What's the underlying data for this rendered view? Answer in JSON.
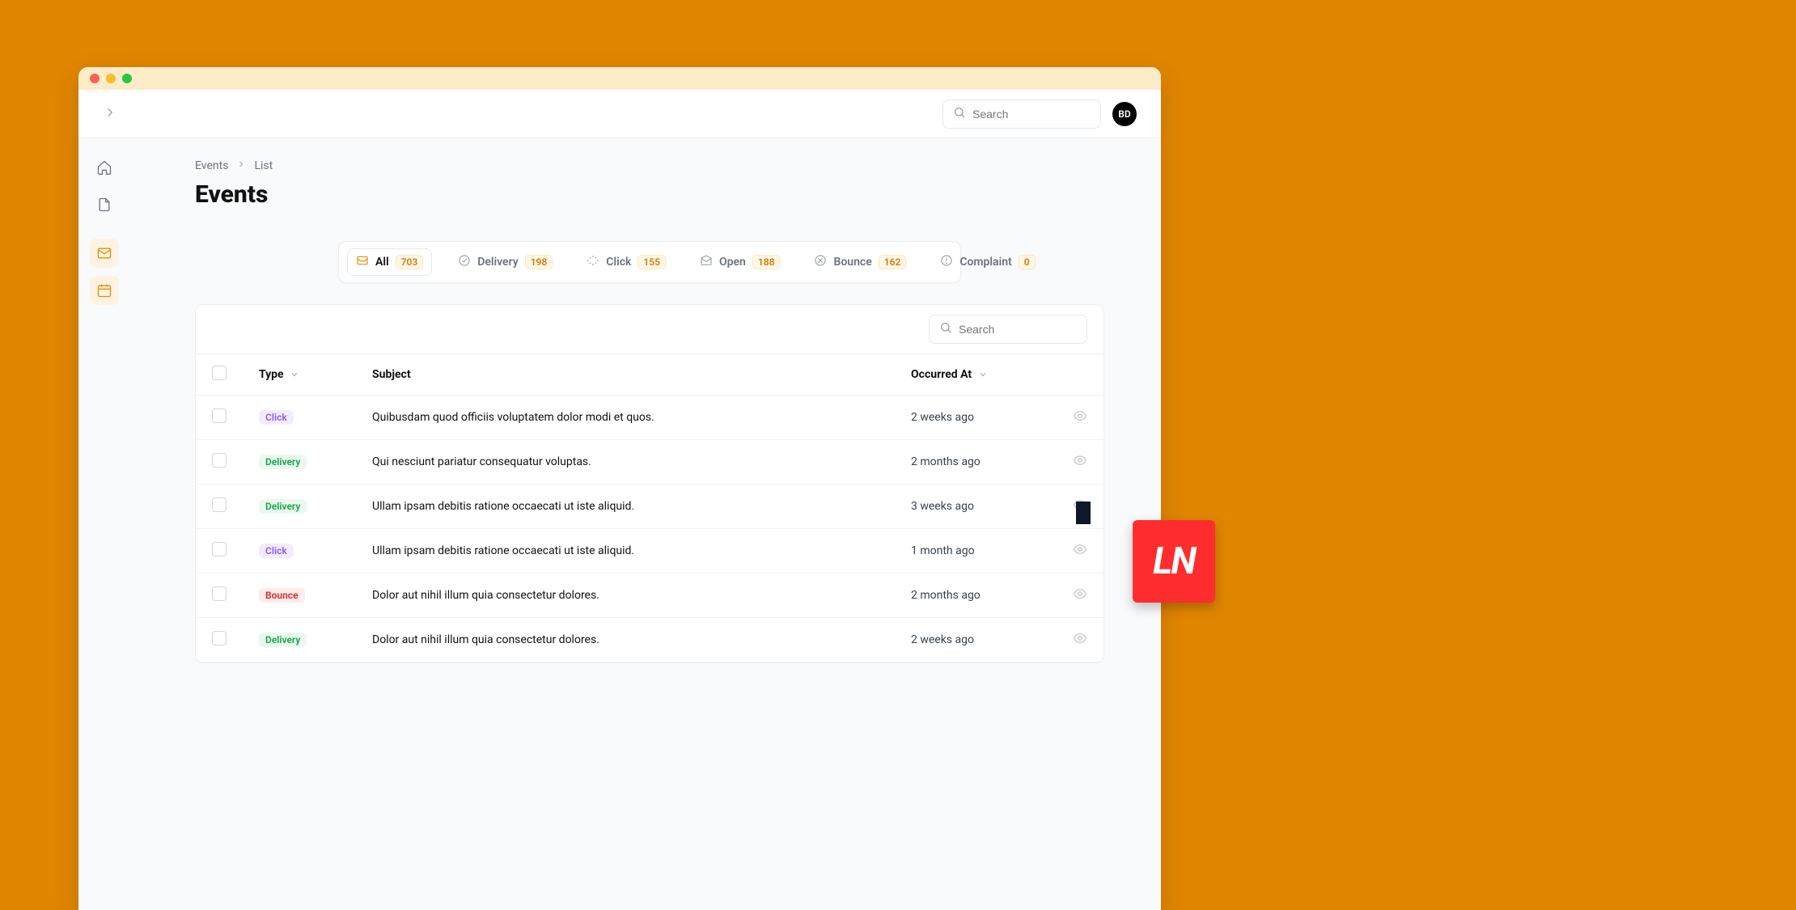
{
  "colors": {
    "accent": "#ea8a0a",
    "bg": "#e08500"
  },
  "header": {
    "search_placeholder": "Search",
    "avatar_initials": "BD"
  },
  "sidebar": {
    "items": [
      {
        "name": "home"
      },
      {
        "name": "document"
      },
      {
        "name": "mail",
        "active": true
      },
      {
        "name": "calendar",
        "active": true
      }
    ]
  },
  "breadcrumbs": {
    "root": "Events",
    "leaf": "List"
  },
  "page_title": "Events",
  "filters": [
    {
      "key": "all",
      "label": "All",
      "count": "703",
      "active": true
    },
    {
      "key": "delivery",
      "label": "Delivery",
      "count": "198"
    },
    {
      "key": "click",
      "label": "Click",
      "count": "155"
    },
    {
      "key": "open",
      "label": "Open",
      "count": "188"
    },
    {
      "key": "bounce",
      "label": "Bounce",
      "count": "162"
    },
    {
      "key": "complaint",
      "label": "Complaint",
      "count": "0"
    }
  ],
  "table": {
    "search_placeholder": "Search",
    "columns": {
      "type": "Type",
      "subject": "Subject",
      "occurred_at": "Occurred At"
    },
    "rows": [
      {
        "type": "Click",
        "subject": "Quibusdam quod officiis voluptatem dolor modi et quos.",
        "occurred_at": "2 weeks ago"
      },
      {
        "type": "Delivery",
        "subject": "Qui nesciunt pariatur consequatur voluptas.",
        "occurred_at": "2 months ago"
      },
      {
        "type": "Delivery",
        "subject": "Ullam ipsam debitis ratione occaecati ut iste aliquid.",
        "occurred_at": "3 weeks ago"
      },
      {
        "type": "Click",
        "subject": "Ullam ipsam debitis ratione occaecati ut iste aliquid.",
        "occurred_at": "1 month ago"
      },
      {
        "type": "Bounce",
        "subject": "Dolor aut nihil illum quia consectetur dolores.",
        "occurred_at": "2 months ago"
      },
      {
        "type": "Delivery",
        "subject": "Dolor aut nihil illum quia consectetur dolores.",
        "occurred_at": "2 weeks ago"
      }
    ]
  },
  "logo_text": "LN"
}
